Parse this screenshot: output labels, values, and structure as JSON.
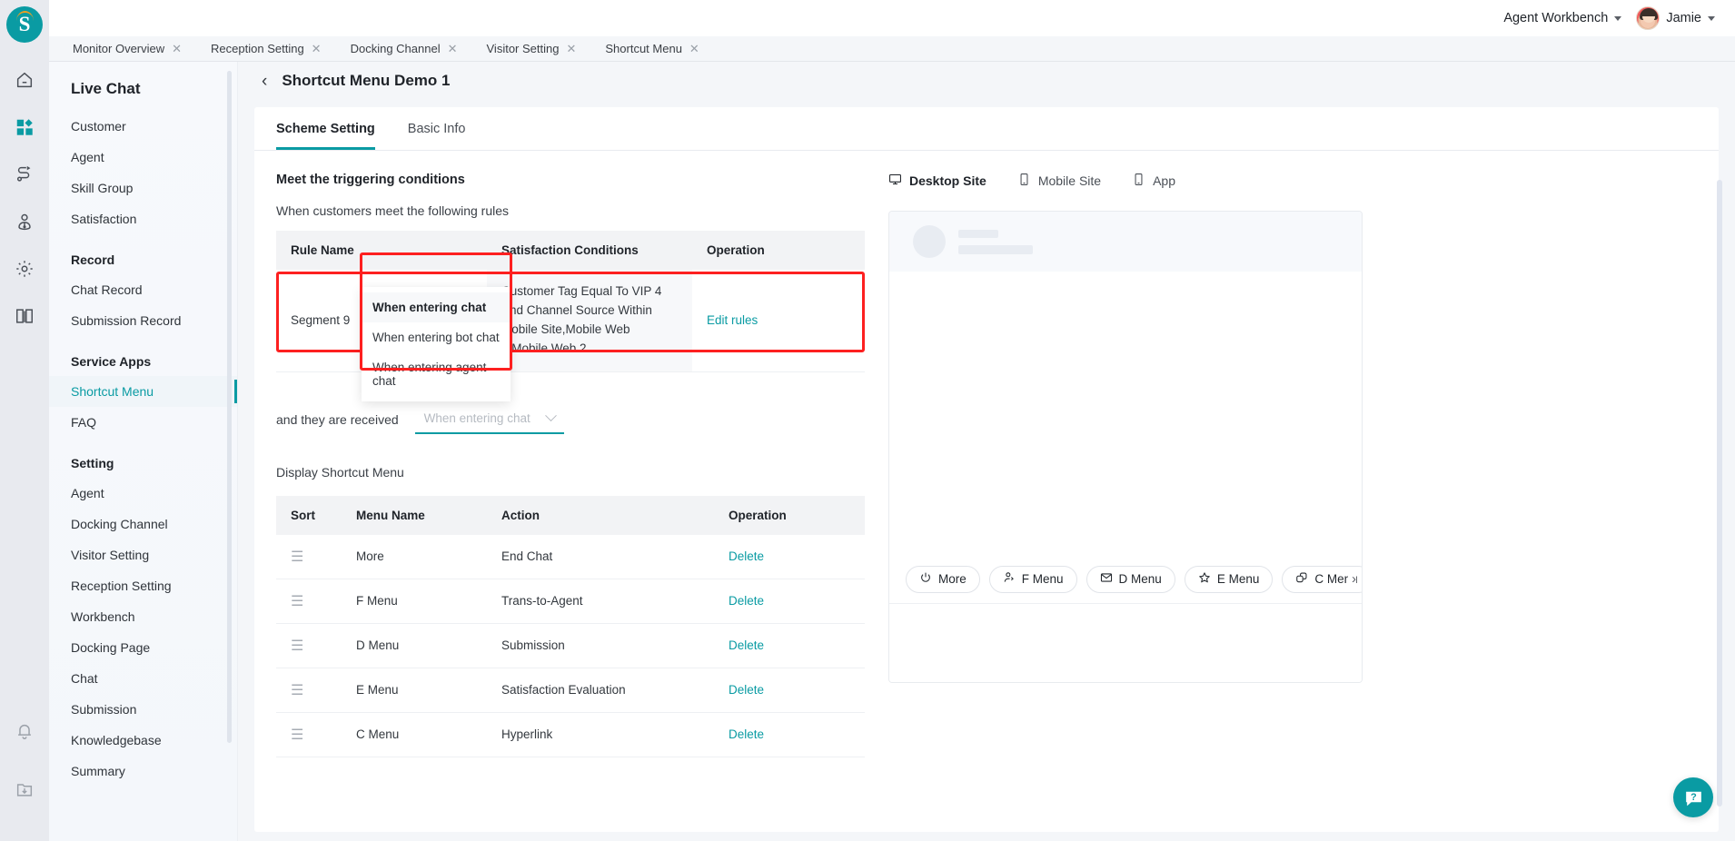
{
  "brand": {
    "logo_letter": "S",
    "accent": "#0a9ba3",
    "highlight": "#fd2020"
  },
  "topbar": {
    "workbench_label": "Agent Workbench",
    "user_name": "Jamie"
  },
  "tabs": [
    {
      "label": "Monitor Overview",
      "close": "✕"
    },
    {
      "label": "Reception Setting",
      "close": "✕"
    },
    {
      "label": "Docking Channel",
      "close": "✕"
    },
    {
      "label": "Visitor Setting",
      "close": "✕"
    },
    {
      "label": "Shortcut Menu",
      "close": "✕"
    }
  ],
  "rail": {
    "icons": [
      "home-icon",
      "apps-grid-icon",
      "routing-flow-icon",
      "visitor-location-icon",
      "gear-icon",
      "knowledge-book-icon"
    ],
    "bottom_icons": [
      "bell-icon",
      "downloads-icon"
    ]
  },
  "sidebar": {
    "title": "Live Chat",
    "items": [
      {
        "label": "Customer",
        "active": false
      },
      {
        "label": "Agent",
        "active": false
      },
      {
        "label": "Skill Group",
        "active": false
      },
      {
        "label": "Satisfaction",
        "active": false
      }
    ],
    "groups": [
      {
        "label": "Record",
        "items": [
          {
            "label": "Chat Record",
            "active": false
          },
          {
            "label": "Submission Record",
            "active": false
          }
        ]
      },
      {
        "label": "Service Apps",
        "items": [
          {
            "label": "Shortcut Menu",
            "active": true
          },
          {
            "label": "FAQ",
            "active": false
          }
        ]
      },
      {
        "label": "Setting",
        "items": [
          {
            "label": "Agent",
            "active": false
          },
          {
            "label": "Docking Channel",
            "active": false
          },
          {
            "label": "Visitor Setting",
            "active": false
          },
          {
            "label": "Reception Setting",
            "active": false
          },
          {
            "label": "Workbench",
            "active": false
          },
          {
            "label": "Docking Page",
            "active": false
          },
          {
            "label": "Chat",
            "active": false
          },
          {
            "label": "Submission",
            "active": false
          },
          {
            "label": "Knowledgebase",
            "active": false
          },
          {
            "label": "Summary",
            "active": false
          }
        ]
      }
    ]
  },
  "page": {
    "back_icon": "‹",
    "title": "Shortcut Menu Demo 1",
    "subtabs": [
      {
        "label": "Scheme Setting",
        "active": true
      },
      {
        "label": "Basic Info",
        "active": false
      }
    ]
  },
  "trigger": {
    "section_title": "Meet the triggering conditions",
    "section_sub": "When customers meet the following rules",
    "columns": [
      "Rule Name",
      "Satisfaction Conditions",
      "Operation"
    ],
    "rows": [
      {
        "rule_name": "Segment 9",
        "conditions": "Customer Tag Equal To VIP 4 And Channel Source Within Mobile Site,Mobile Web 3,Mobile Web 2",
        "operation": "Edit rules"
      }
    ]
  },
  "received": {
    "label": "and they are received",
    "select_placeholder": "When entering chat",
    "select_value": "",
    "options": [
      {
        "label": "When entering chat",
        "selected": true
      },
      {
        "label": "When entering bot chat",
        "selected": false
      },
      {
        "label": "When entering agent chat",
        "selected": false
      }
    ]
  },
  "display": {
    "title": "Display Shortcut Menu",
    "columns": [
      "Sort",
      "Menu Name",
      "Action",
      "Operation"
    ],
    "rows": [
      {
        "sort": "drag-handle-icon",
        "menu_name": "More",
        "action": "End Chat",
        "operation": "Delete"
      },
      {
        "sort": "drag-handle-icon",
        "menu_name": "F Menu",
        "action": "Trans-to-Agent",
        "operation": "Delete"
      },
      {
        "sort": "drag-handle-icon",
        "menu_name": "D Menu",
        "action": "Submission",
        "operation": "Delete"
      },
      {
        "sort": "drag-handle-icon",
        "menu_name": "E Menu",
        "action": "Satisfaction Evaluation",
        "operation": "Delete"
      },
      {
        "sort": "drag-handle-icon",
        "menu_name": "C Menu",
        "action": "Hyperlink",
        "operation": "Delete"
      }
    ]
  },
  "preview": {
    "tabs": [
      {
        "label": "Desktop Site",
        "icon": "monitor-icon",
        "active": true
      },
      {
        "label": "Mobile Site",
        "icon": "mobile-icon",
        "active": false
      },
      {
        "label": "App",
        "icon": "app-icon",
        "active": false
      }
    ],
    "chips": [
      {
        "label": "More",
        "icon": "power-icon"
      },
      {
        "label": "F Menu",
        "icon": "transfer-agent-icon"
      },
      {
        "label": "D Menu",
        "icon": "envelope-icon"
      },
      {
        "label": "E Menu",
        "icon": "star-icon"
      },
      {
        "label": "C Menu",
        "icon": "link-icon"
      }
    ],
    "overflow_icon": "›"
  },
  "help": {
    "icon": "help-chat-icon",
    "label": "?"
  }
}
